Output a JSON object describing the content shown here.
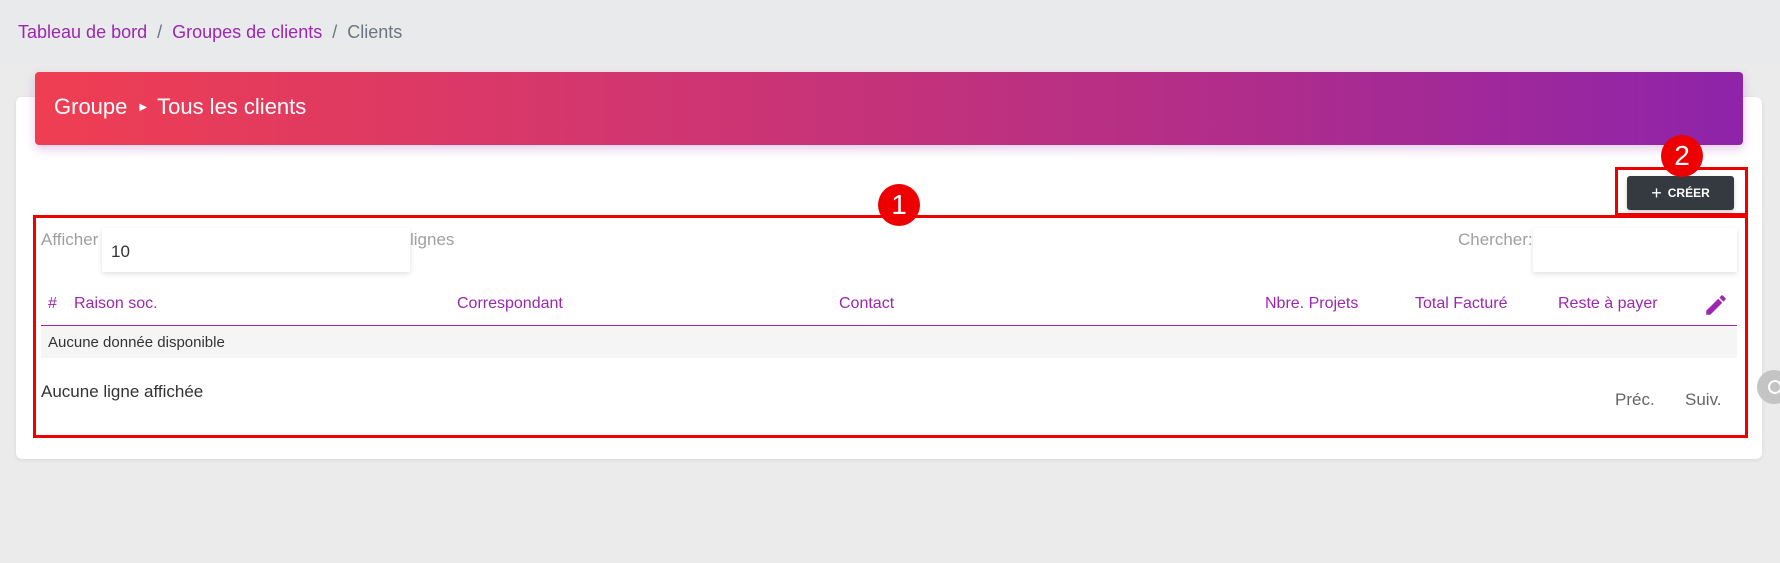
{
  "breadcrumb": {
    "items": [
      "Tableau de bord",
      "Groupes de clients"
    ],
    "current": "Clients",
    "separator": "/"
  },
  "header": {
    "group_label": "Groupe",
    "title": "Tous les clients",
    "chevron_icon": "caret-right-icon"
  },
  "toolbar": {
    "create_label": "CRÉER",
    "create_icon": "plus-icon"
  },
  "table_controls": {
    "show_label": "Afficher",
    "length_value": "10",
    "lines_label": "lignes",
    "search_label": "Chercher:",
    "search_value": ""
  },
  "table": {
    "columns": [
      "#",
      "Raison soc.",
      "Correspondant",
      "Contact",
      "Nbre. Projets",
      "Total Facturé",
      "Reste à payer"
    ],
    "edit_icon": "pencil-icon",
    "empty_message": "Aucune donnée disponible"
  },
  "footer": {
    "info": "Aucune ligne affichée",
    "prev_label": "Préc.",
    "next_label": "Suiv."
  },
  "annotations": {
    "badge_1": "1",
    "badge_2": "2"
  },
  "colors": {
    "accent": "#9c27b0",
    "banner_start": "#ef3e52",
    "banner_end": "#8e24aa",
    "highlight": "#ee0000",
    "button_dark": "#343a40"
  }
}
